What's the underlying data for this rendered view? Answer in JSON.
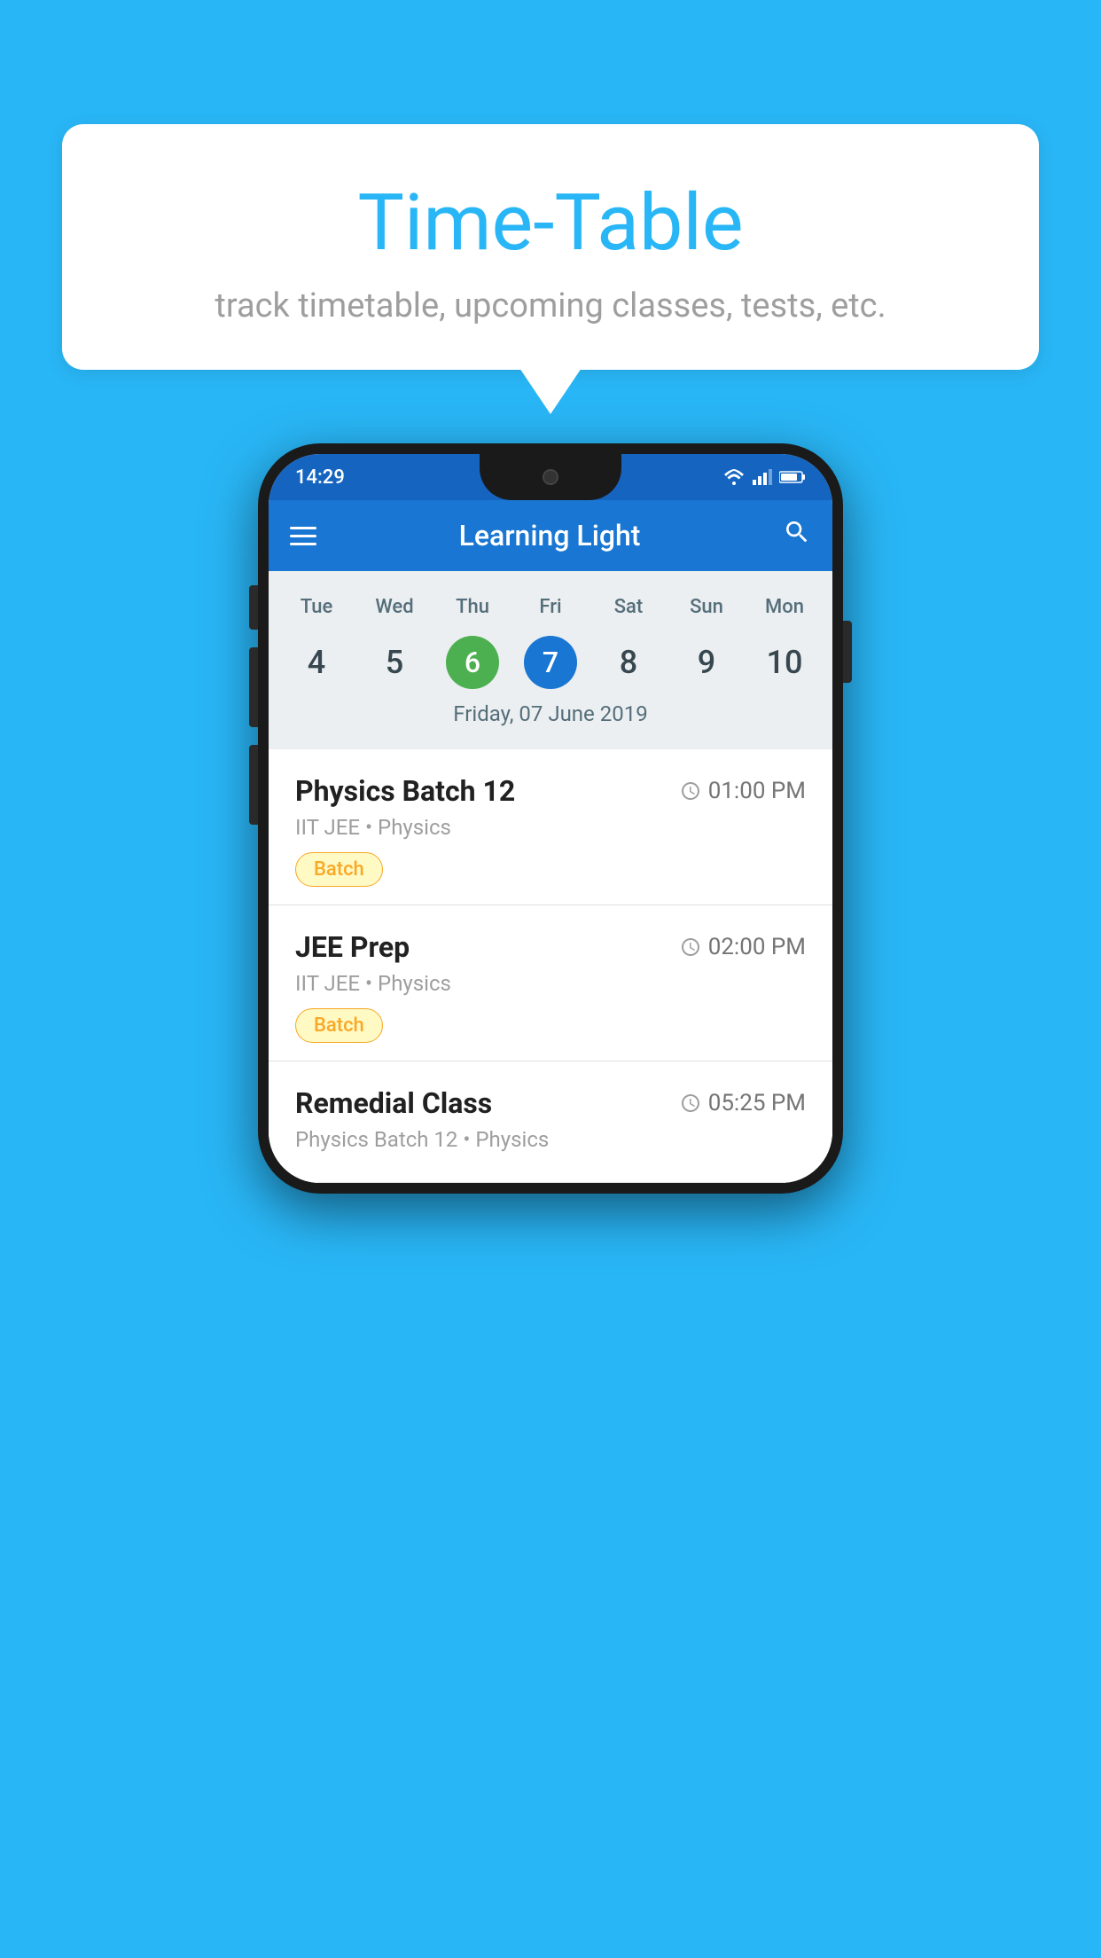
{
  "background_color": "#29B6F6",
  "speech_bubble": {
    "title": "Time-Table",
    "subtitle": "track timetable, upcoming classes, tests, etc."
  },
  "phone": {
    "status_bar": {
      "time": "14:29"
    },
    "app_bar": {
      "title": "Learning Light"
    },
    "calendar": {
      "days": [
        "Tue",
        "Wed",
        "Thu",
        "Fri",
        "Sat",
        "Sun",
        "Mon"
      ],
      "dates": [
        "4",
        "5",
        "6",
        "7",
        "8",
        "9",
        "10"
      ],
      "today_index": 2,
      "selected_index": 3,
      "selected_date_label": "Friday, 07 June 2019"
    },
    "schedule": [
      {
        "title": "Physics Batch 12",
        "time": "01:00 PM",
        "subtitle": "IIT JEE • Physics",
        "tag": "Batch"
      },
      {
        "title": "JEE Prep",
        "time": "02:00 PM",
        "subtitle": "IIT JEE • Physics",
        "tag": "Batch"
      },
      {
        "title": "Remedial Class",
        "time": "05:25 PM",
        "subtitle": "Physics Batch 12 • Physics",
        "tag": null
      }
    ]
  }
}
